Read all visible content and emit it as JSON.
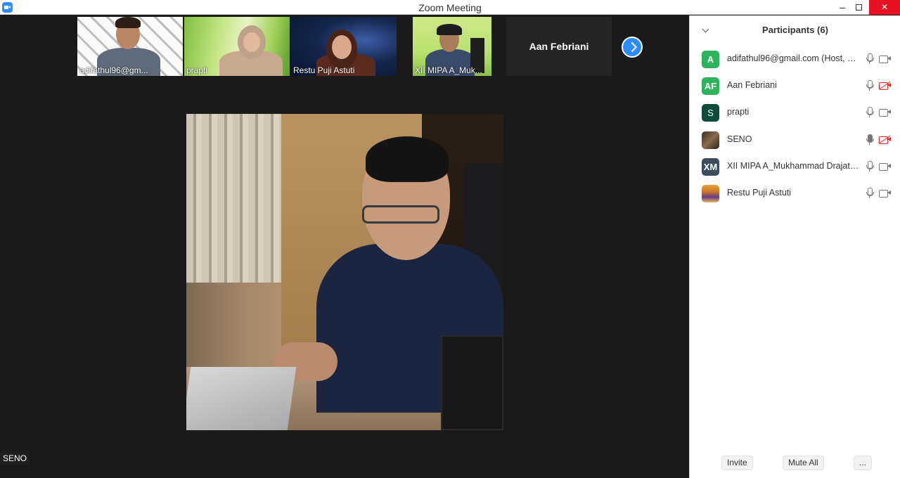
{
  "window": {
    "title": "Zoom Meeting"
  },
  "thumbnails": [
    {
      "name": "adifathul96@gm..."
    },
    {
      "name": "prapti"
    },
    {
      "name": "Restu Puji Astuti"
    },
    {
      "name": "XII MIPA A_Muk..."
    },
    {
      "name": "Aan Febriani"
    }
  ],
  "speaker": {
    "name": "SENO"
  },
  "panel": {
    "title": "Participants (6)",
    "participants": [
      {
        "avatar": "A",
        "avatar_color": "#2db35b",
        "name": "adifathul96@gmail.com (Host, me)",
        "video": "on"
      },
      {
        "avatar": "AF",
        "avatar_color": "#2db35b",
        "name": "Aan Febriani",
        "video": "off"
      },
      {
        "avatar": "S",
        "avatar_color": "#0f4a3a",
        "name": "prapti",
        "video": "on"
      },
      {
        "avatar": "",
        "avatar_color": "#5a4a3a",
        "name": "SENO",
        "video": "off",
        "mic": "active"
      },
      {
        "avatar": "XM",
        "avatar_color": "#3d4c5c",
        "name": "XII MIPA A_Mukhammad Drajat K...",
        "video": "on"
      },
      {
        "avatar": "",
        "avatar_color": "#c78a2a",
        "name": "Restu Puji Astuti",
        "video": "on"
      }
    ],
    "footer": {
      "invite": "Invite",
      "mute_all": "Mute All",
      "more": "..."
    }
  },
  "colors": {
    "accent": "#2d8cff",
    "video_off": "#e02828",
    "close": "#e81123"
  }
}
